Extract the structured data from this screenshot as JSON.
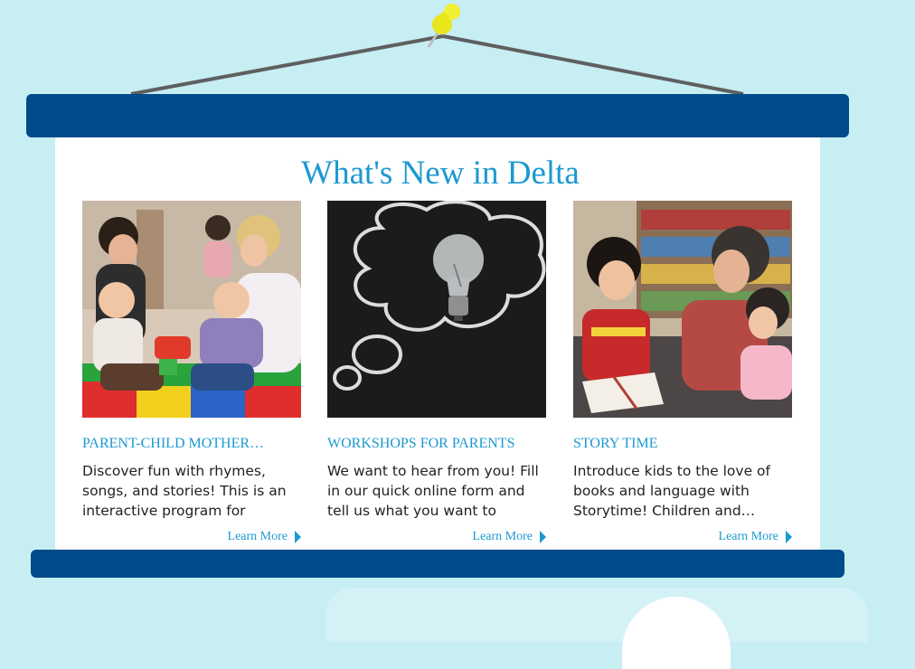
{
  "section": {
    "title": "What's New in Delta"
  },
  "cards": [
    {
      "heading": "PARENT-CHILD MOTHER…",
      "description": "Discover fun with rhymes, songs, and stories! This is an interactive program for babies…",
      "learn_more": "Learn More",
      "image_icon": "family-photo-icon"
    },
    {
      "heading": "WORKSHOPS FOR PARENTS",
      "description": "We want to hear from you! Fill in our quick online form and tell us what you want to learn…",
      "learn_more": "Learn More",
      "image_icon": "lightbulb-photo-icon"
    },
    {
      "heading": "STORY TIME",
      "description": "Introduce kids to the love of books and language with Storytime! Children and…",
      "learn_more": "Learn More",
      "image_icon": "storytime-photo-icon"
    }
  ],
  "colors": {
    "accent": "#1c99d0",
    "rod": "#004b8a",
    "background": "#c6eef3"
  }
}
